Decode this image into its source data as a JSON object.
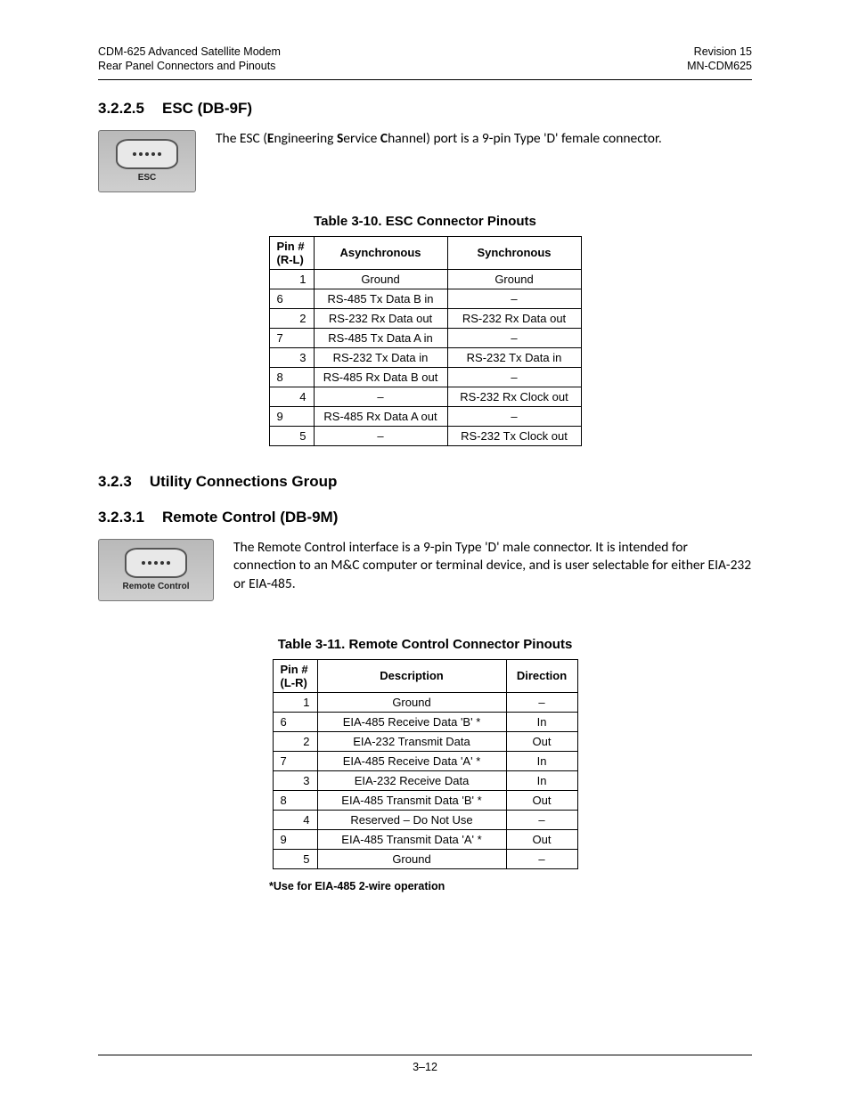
{
  "header": {
    "left1": "CDM-625 Advanced Satellite Modem",
    "left2": "Rear Panel Connectors and Pinouts",
    "right1": "Revision 15",
    "right2": "MN-CDM625"
  },
  "sections": {
    "s1": {
      "num": "3.2.2.5",
      "title": "ESC (DB-9F)"
    },
    "s1_img_label": "ESC",
    "s1_body_pre": "The ESC (",
    "s1_body_b1": "E",
    "s1_body_m1": "ngineering ",
    "s1_body_b2": "S",
    "s1_body_m2": "ervice ",
    "s1_body_b3": "C",
    "s1_body_post": "hannel) port is a 9-pin Type 'D' female connector.",
    "s2": {
      "num": "3.2.3",
      "title": "Utility Connections Group"
    },
    "s3": {
      "num": "3.2.3.1",
      "title": "Remote Control (DB-9M)"
    },
    "s3_img_label": "Remote Control",
    "s3_body": "The Remote Control interface is a 9-pin Type 'D' male connector. It is intended for connection to an M&C computer or terminal device, and is user selectable for either EIA-232 or EIA-485."
  },
  "table1": {
    "caption": "Table 3-10.  ESC Connector Pinouts",
    "head_pin_l1": "Pin #",
    "head_pin_l2": "(R-L)",
    "head_async": "Asynchronous",
    "head_sync": "Synchronous",
    "rows": [
      {
        "pin": "1",
        "align": "right",
        "async": "Ground",
        "sync": "Ground"
      },
      {
        "pin": "6",
        "align": "left",
        "async": "RS-485 Tx Data B in",
        "sync": "–"
      },
      {
        "pin": "2",
        "align": "right",
        "async": "RS-232 Rx Data out",
        "sync": "RS-232 Rx Data out"
      },
      {
        "pin": "7",
        "align": "left",
        "async": "RS-485 Tx Data A in",
        "sync": "–"
      },
      {
        "pin": "3",
        "align": "right",
        "async": "RS-232 Tx Data in",
        "sync": "RS-232 Tx Data in"
      },
      {
        "pin": "8",
        "align": "left",
        "async": "RS-485 Rx Data B out",
        "sync": "–"
      },
      {
        "pin": "4",
        "align": "right",
        "async": "–",
        "sync": "RS-232 Rx Clock out"
      },
      {
        "pin": "9",
        "align": "left",
        "async": "RS-485 Rx Data A out",
        "sync": "–"
      },
      {
        "pin": "5",
        "align": "right",
        "async": "–",
        "sync": "RS-232 Tx Clock out"
      }
    ]
  },
  "table2": {
    "caption": "Table 3-11.  Remote Control Connector Pinouts",
    "head_pin_l1": "Pin #",
    "head_pin_l2": "(L-R)",
    "head_desc": "Description",
    "head_dir": "Direction",
    "rows": [
      {
        "pin": "1",
        "align": "right",
        "desc": "Ground",
        "dir": "–"
      },
      {
        "pin": "6",
        "align": "left",
        "desc": "EIA-485 Receive Data 'B' *",
        "dir": "In"
      },
      {
        "pin": "2",
        "align": "right",
        "desc": "EIA-232 Transmit Data",
        "dir": "Out"
      },
      {
        "pin": "7",
        "align": "left",
        "desc": "EIA-485 Receive Data 'A' *",
        "dir": "In"
      },
      {
        "pin": "3",
        "align": "right",
        "desc": "EIA-232 Receive Data",
        "dir": "In"
      },
      {
        "pin": "8",
        "align": "left",
        "desc": "EIA-485 Transmit Data 'B' *",
        "dir": "Out"
      },
      {
        "pin": "4",
        "align": "right",
        "desc": "Reserved – Do Not Use",
        "dir": "–"
      },
      {
        "pin": "9",
        "align": "left",
        "desc": "EIA-485 Transmit Data 'A' *",
        "dir": "Out"
      },
      {
        "pin": "5",
        "align": "right",
        "desc": "Ground",
        "dir": "–"
      }
    ],
    "footnote": "*Use for EIA-485 2-wire operation"
  },
  "page_num": "3–12"
}
